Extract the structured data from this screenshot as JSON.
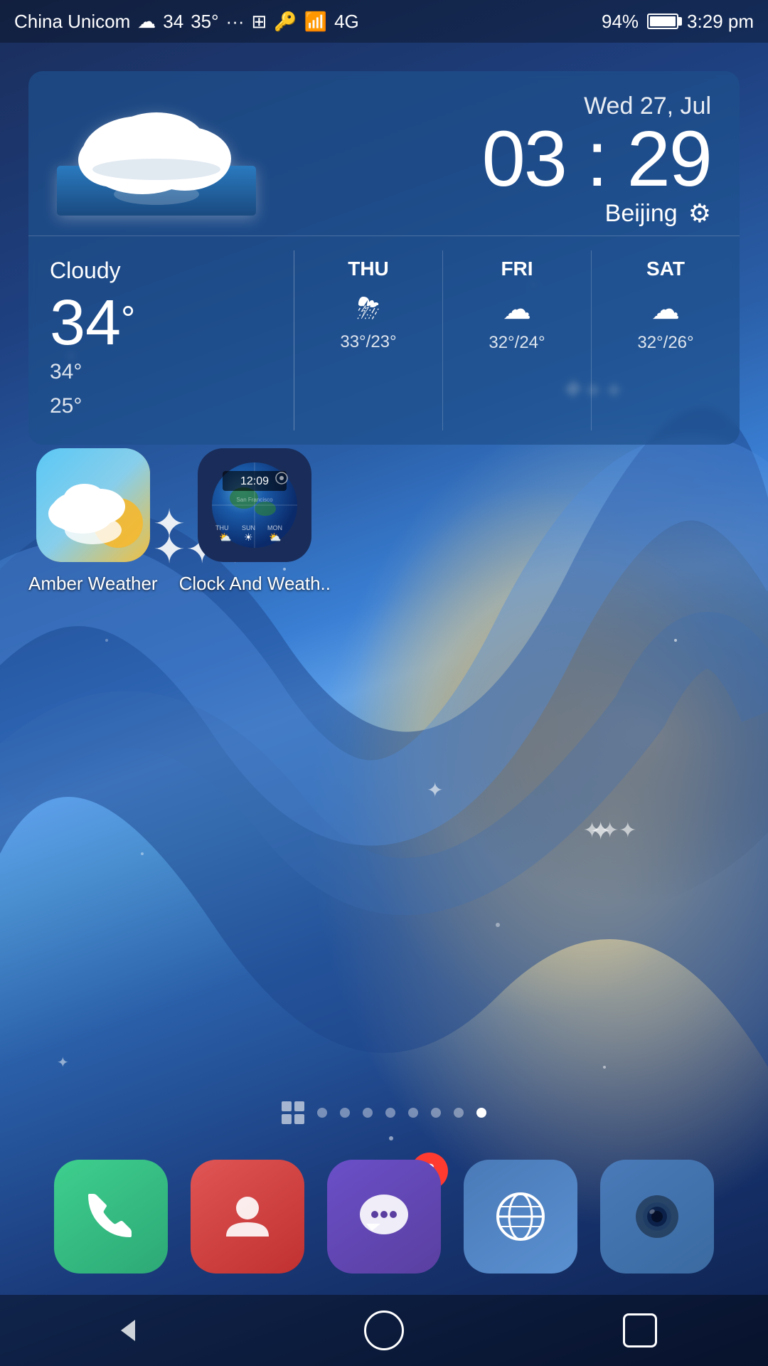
{
  "statusBar": {
    "carrier": "China Unicom",
    "weatherIcon": "☁",
    "temp": "34",
    "high": "35°",
    "dots": "···",
    "batteryPercent": "94%",
    "time": "3:29 pm"
  },
  "weatherWidget": {
    "date": "Wed 27, Jul",
    "time": "03 : 29",
    "location": "Beijing",
    "condition": "Cloudy",
    "currentTemp": "34",
    "highTemp": "34°",
    "lowTemp": "25°",
    "forecast": [
      {
        "day": "THU",
        "icon": "⛈",
        "temps": "33°/23°"
      },
      {
        "day": "FRI",
        "icon": "☁",
        "temps": "32°/24°"
      },
      {
        "day": "SAT",
        "icon": "☁",
        "temps": "32°/26°"
      }
    ]
  },
  "apps": [
    {
      "name": "Amber Weather",
      "icon": "amber"
    },
    {
      "name": "Clock And Weath..",
      "icon": "clock-weather"
    }
  ],
  "dock": [
    {
      "name": "Phone",
      "icon": "📞",
      "type": "phone"
    },
    {
      "name": "Contacts",
      "icon": "👤",
      "type": "contacts"
    },
    {
      "name": "Messages",
      "icon": "💬",
      "type": "messages",
      "badge": "6"
    },
    {
      "name": "Browser",
      "icon": "🌐",
      "type": "browser"
    },
    {
      "name": "Camera",
      "icon": "📷",
      "type": "camera"
    }
  ],
  "pageIndicators": {
    "total": 8,
    "active": 8
  },
  "navigation": {
    "back": "◁",
    "home": "",
    "recent": ""
  }
}
